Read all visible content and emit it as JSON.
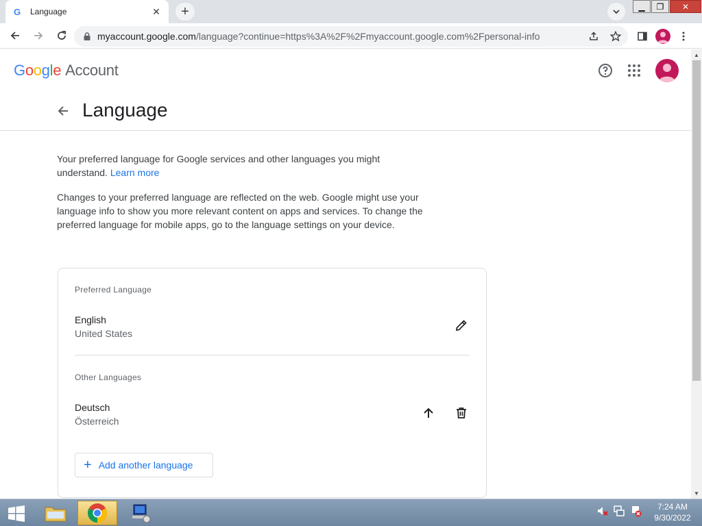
{
  "browser": {
    "tab_title": "Language",
    "url_host": "myaccount.google.com",
    "url_path": "/language?continue=https%3A%2F%2Fmyaccount.google.com%2Fpersonal-info"
  },
  "header": {
    "logo": {
      "g1": "G",
      "o1": "o",
      "o2": "o",
      "g2": "g",
      "l": "l",
      "e": "e"
    },
    "account_label": "Account"
  },
  "page": {
    "title": "Language",
    "intro_1": "Your preferred language for Google services and other languages you might understand.",
    "learn_more": "Learn more",
    "intro_2": "Changes to your preferred language are reflected on the web. Google might use your language info to show you more relevant content on apps and services. To change the preferred language for mobile apps, go to the language settings on your device."
  },
  "card": {
    "preferred_label": "Preferred Language",
    "preferred": {
      "name": "English",
      "region": "United States"
    },
    "other_label": "Other Languages",
    "other": [
      {
        "name": "Deutsch",
        "region": "Österreich"
      }
    ],
    "add_button": "Add another language",
    "add_plus": "+"
  },
  "taskbar": {
    "time": "7:24 AM",
    "date": "9/30/2022"
  },
  "colors": {
    "accent": "#1a73e8",
    "avatar": "#c2185b"
  },
  "icons": [
    "google-favicon-icon",
    "close-icon",
    "plus-icon",
    "chevron-down-icon",
    "back-icon",
    "forward-icon",
    "reload-icon",
    "lock-icon",
    "share-icon",
    "star-icon",
    "side-panel-icon",
    "profile-icon",
    "menu-icon",
    "help-icon",
    "apps-icon",
    "arrow-back-icon",
    "edit-icon",
    "arrow-up-icon",
    "delete-icon",
    "windows-start-icon"
  ]
}
